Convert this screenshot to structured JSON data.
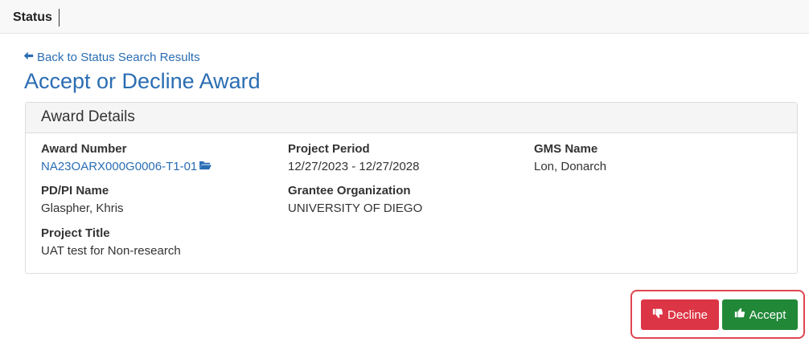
{
  "header": {
    "title": "Status"
  },
  "back_link": {
    "label": "Back to Status Search Results"
  },
  "page_title": "Accept or Decline Award",
  "award_details": {
    "heading": "Award Details",
    "award_number": {
      "label": "Award Number",
      "value": "NA23OARX000G0006-T1-01"
    },
    "project_period": {
      "label": "Project Period",
      "value": "12/27/2023 - 12/27/2028"
    },
    "gms_name": {
      "label": "GMS Name",
      "value": "Lon, Donarch"
    },
    "pd_pi_name": {
      "label": "PD/PI Name",
      "value": "Glaspher, Khris"
    },
    "grantee_org": {
      "label": "Grantee Organization",
      "value": "UNIVERSITY OF DIEGO"
    },
    "project_title": {
      "label": "Project Title",
      "value": "UAT test for Non-research"
    }
  },
  "actions": {
    "decline_label": "Decline",
    "accept_label": "Accept"
  },
  "colors": {
    "link": "#2a6db3",
    "decline": "#dc3545",
    "accept": "#218838",
    "highlight": "#e0454f"
  },
  "icons": {
    "back": "arrow-left-icon",
    "folder": "folder-open-icon",
    "decline": "thumbs-down-icon",
    "accept": "thumbs-up-icon"
  }
}
